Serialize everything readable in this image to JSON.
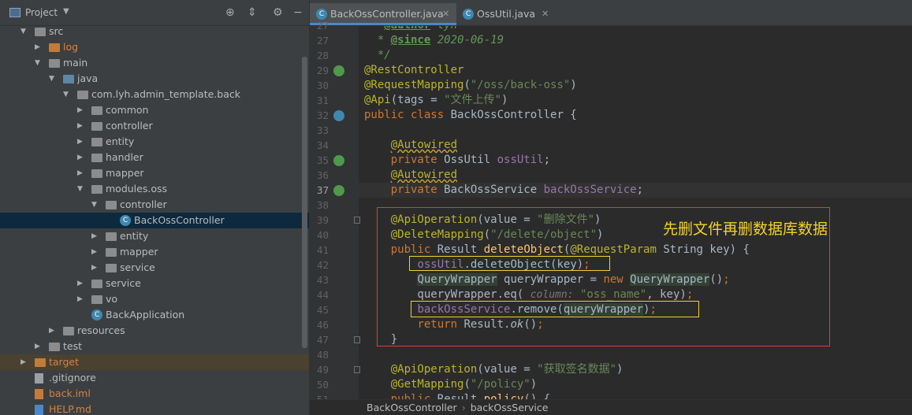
{
  "project_panel": {
    "title": "Project",
    "tree": [
      {
        "label": "src",
        "depth": 0,
        "arrow": "▼",
        "icon": "folder"
      },
      {
        "label": "log",
        "depth": 1,
        "arrow": "▶",
        "icon": "folder-orange",
        "style": "orange"
      },
      {
        "label": "main",
        "depth": 1,
        "arrow": "▼",
        "icon": "folder"
      },
      {
        "label": "java",
        "depth": 2,
        "arrow": "▼",
        "icon": "folder-src"
      },
      {
        "label": "com.lyh.admin_template.back",
        "depth": 3,
        "arrow": "▼",
        "icon": "package"
      },
      {
        "label": "common",
        "depth": 4,
        "arrow": "▶",
        "icon": "package"
      },
      {
        "label": "controller",
        "depth": 4,
        "arrow": "▶",
        "icon": "package"
      },
      {
        "label": "entity",
        "depth": 4,
        "arrow": "▶",
        "icon": "package"
      },
      {
        "label": "handler",
        "depth": 4,
        "arrow": "▶",
        "icon": "package"
      },
      {
        "label": "mapper",
        "depth": 4,
        "arrow": "▶",
        "icon": "package"
      },
      {
        "label": "modules.oss",
        "depth": 4,
        "arrow": "▼",
        "icon": "package"
      },
      {
        "label": "controller",
        "depth": 5,
        "arrow": "▼",
        "icon": "package"
      },
      {
        "label": "BackOssController",
        "depth": 6,
        "arrow": "",
        "icon": "class",
        "selected": true
      },
      {
        "label": "entity",
        "depth": 5,
        "arrow": "▶",
        "icon": "package"
      },
      {
        "label": "mapper",
        "depth": 5,
        "arrow": "▶",
        "icon": "package"
      },
      {
        "label": "service",
        "depth": 5,
        "arrow": "▶",
        "icon": "package"
      },
      {
        "label": "service",
        "depth": 4,
        "arrow": "▶",
        "icon": "package"
      },
      {
        "label": "vo",
        "depth": 4,
        "arrow": "▶",
        "icon": "package"
      },
      {
        "label": "BackApplication",
        "depth": 4,
        "arrow": "",
        "icon": "class-app"
      },
      {
        "label": "resources",
        "depth": 2,
        "arrow": "▶",
        "icon": "folder-res"
      },
      {
        "label": "test",
        "depth": 1,
        "arrow": "▶",
        "icon": "folder"
      },
      {
        "label": "target",
        "depth": 0,
        "arrow": "▶",
        "icon": "folder-orange",
        "style": "orange",
        "excluded": true
      },
      {
        "label": ".gitignore",
        "depth": 0,
        "arrow": "",
        "icon": "file"
      },
      {
        "label": "back.iml",
        "depth": 0,
        "arrow": "",
        "icon": "file-xml",
        "style": "orange"
      },
      {
        "label": "HELP.md",
        "depth": 0,
        "arrow": "",
        "icon": "file-md",
        "style": "orange"
      }
    ]
  },
  "tabs": [
    {
      "label": "BackOssController.java",
      "active": true
    },
    {
      "label": "OssUtil.java",
      "active": false
    }
  ],
  "lines": [
    {
      "n": "27",
      "html": "   <span class=\"tag\">@author</span><span class=\"com\"> lyh</span>"
    },
    {
      "n": "27",
      "html": "<span class=\"com\">  * </span><span class=\"tag\">@since</span><span class=\"com\"> 2020-06-19</span>"
    },
    {
      "n": "28",
      "html": "<span class=\"com\">  */</span>"
    },
    {
      "n": "29",
      "html": "<span class=\"ann\">@RestController</span>"
    },
    {
      "n": "30",
      "html": "<span class=\"ann\">@RequestMapping</span>(<span class=\"str\">\"/oss/back-oss\"</span>)"
    },
    {
      "n": "31",
      "html": "<span class=\"ann\">@Api</span>(tags = <span class=\"str\">\"文件上传\"</span>)"
    },
    {
      "n": "32",
      "html": "<span class=\"kw\">public class </span>BackOssController {"
    },
    {
      "n": "33",
      "html": ""
    },
    {
      "n": "34",
      "html": "    <span class=\"ann warn\">@Autowired</span>"
    },
    {
      "n": "35",
      "html": "    <span class=\"kw\">private </span>OssUtil <span class=\"fld\">ossUtil</span>;"
    },
    {
      "n": "36",
      "html": "    <span class=\"ann warn\">@Autowired</span>"
    },
    {
      "n": "37",
      "html": "    <span class=\"kw\">private </span>BackOssService <span class=\"fld\">backOssService</span>;",
      "current": true
    },
    {
      "n": "38",
      "html": ""
    },
    {
      "n": "39",
      "html": "    <span class=\"ann\">@ApiOperation</span>(value = <span class=\"str\">\"删除文件\"</span>)"
    },
    {
      "n": "40",
      "html": "    <span class=\"ann\">@DeleteMapping</span>(<span class=\"str\">\"/delete/object\"</span>)"
    },
    {
      "n": "41",
      "html": "    <span class=\"kw\">public </span>Result <span class=\"fn\">deleteObject</span>(<span class=\"ann\">@RequestParam</span> String key) {"
    },
    {
      "n": "42",
      "html": "        <span class=\"fld\">ossUtil</span>.deleteObject(key)<span class=\"kw\">;</span>"
    },
    {
      "n": "43",
      "html": "        <span class=\"bg-hl\">QueryWrapper</span> queryWrapper = <span class=\"kw\">new </span><span class=\"bg-hl\">QueryWrapper</span>()<span class=\"kw\">;</span>"
    },
    {
      "n": "44",
      "html": "        queryWrapper.eq( <span class=\"hint\">column:</span> <span class=\"str\">\"oss_name\"</span>, key)<span class=\"kw\">;</span>"
    },
    {
      "n": "45",
      "html": "        <span class=\"fld\">backOssService</span>.remove(<span class=\"bg-hl\">queryWrapper</span>)<span class=\"kw\">;</span>"
    },
    {
      "n": "46",
      "html": "        <span class=\"kw\">return </span>Result.<span class=\"ital\">ok</span>()<span class=\"kw\">;</span>"
    },
    {
      "n": "47",
      "html": "    }"
    },
    {
      "n": "48",
      "html": ""
    },
    {
      "n": "49",
      "html": "    <span class=\"ann\">@ApiOperation</span>(value = <span class=\"str\">\"获取签名数据\"</span>)"
    },
    {
      "n": "50",
      "html": "    <span class=\"ann\">@GetMapping</span>(<span class=\"str\">\"/policy\"</span>)"
    },
    {
      "n": "51",
      "html": "    <span class=\"kw\">public </span>Result <span class=\"fn\">policy</span>() {"
    }
  ],
  "annotation_note": "先删文件再删数据库数据",
  "breadcrumb": {
    "first": "BackOssController",
    "second": "backOssService"
  }
}
